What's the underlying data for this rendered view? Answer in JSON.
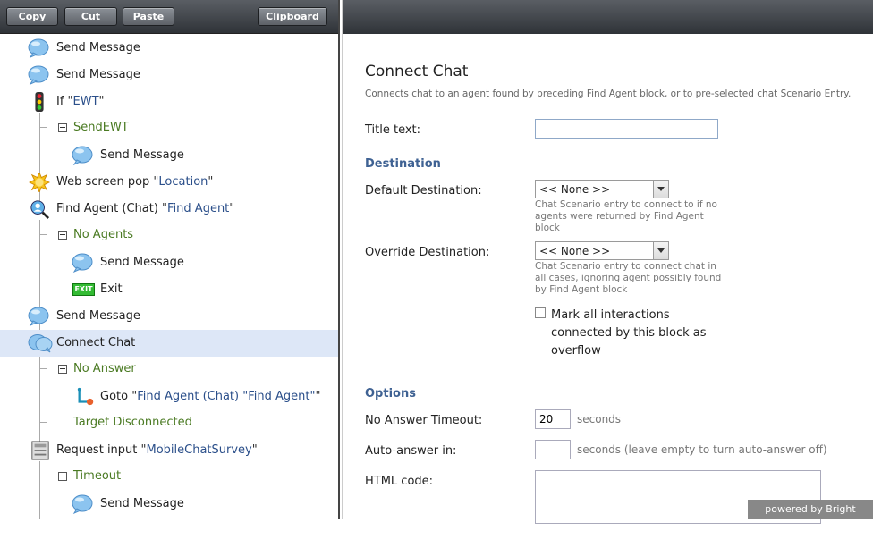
{
  "toolbar": {
    "copy": "Copy",
    "cut": "Cut",
    "paste": "Paste",
    "clipboard": "Clipboard"
  },
  "tree": [
    {
      "icon": "chat-bubble-icon",
      "label": "Send Message",
      "quoted": ""
    },
    {
      "icon": "chat-bubble-icon",
      "label": "Send Message",
      "quoted": ""
    },
    {
      "icon": "traffic-light-icon",
      "label": "If ",
      "quoted": "EWT"
    },
    {
      "branch": true,
      "label": "SendEWT"
    },
    {
      "icon": "chat-bubble-icon",
      "label": "Send Message",
      "quoted": ""
    },
    {
      "icon": "web-screen-pop-icon",
      "label": "Web screen pop ",
      "quoted": "Location"
    },
    {
      "icon": "find-agent-icon",
      "label": "Find Agent (Chat) ",
      "quoted": "Find Agent"
    },
    {
      "branch": true,
      "label": "No Agents"
    },
    {
      "icon": "chat-bubble-icon",
      "label": "Send Message",
      "quoted": ""
    },
    {
      "icon": "exit-icon",
      "label": "Exit",
      "quoted": ""
    },
    {
      "icon": "chat-bubble-icon",
      "label": "Send Message",
      "quoted": ""
    },
    {
      "icon": "connect-chat-icon",
      "label": "Connect Chat",
      "quoted": "",
      "selected": true
    },
    {
      "branch": true,
      "label": "No Answer"
    },
    {
      "icon": "goto-icon",
      "label": "Goto ",
      "quoted": "Find Agent (Chat) \"Find Agent\""
    },
    {
      "branch": true,
      "label": "Target Disconnected",
      "noexpander": true
    },
    {
      "icon": "request-input-icon",
      "label": "Request input ",
      "quoted": "MobileChatSurvey"
    },
    {
      "branch": true,
      "label": "Timeout"
    },
    {
      "icon": "chat-bubble-icon",
      "label": "Send Message",
      "quoted": ""
    }
  ],
  "exit_icon_text": "EXIT",
  "form": {
    "title": "Connect Chat",
    "description": "Connects chat to an agent found by preceding Find Agent block, or to pre-selected chat Scenario Entry.",
    "title_text_label": "Title text:",
    "title_text_value": "",
    "destination_header": "Destination",
    "default_dest_label": "Default Destination:",
    "default_dest_value": "<< None >>",
    "default_dest_help": "Chat Scenario entry to connect to if no agents were returned by Find Agent block",
    "override_dest_label": "Override Destination:",
    "override_dest_value": "<< None >>",
    "override_dest_help": "Chat Scenario entry to connect chat in all cases, ignoring agent possibly found by Find Agent block",
    "overflow_checkbox_label": "Mark all interactions connected by this block as overflow",
    "overflow_checked": false,
    "options_header": "Options",
    "no_answer_label": "No Answer Timeout:",
    "no_answer_value": "20",
    "no_answer_unit": "seconds",
    "auto_answer_label": "Auto-answer in:",
    "auto_answer_value": "",
    "auto_answer_unit": "seconds (leave empty to turn auto-answer off)",
    "html_code_label": "HTML code:"
  },
  "powered_by": "powered by Bright Pattern"
}
